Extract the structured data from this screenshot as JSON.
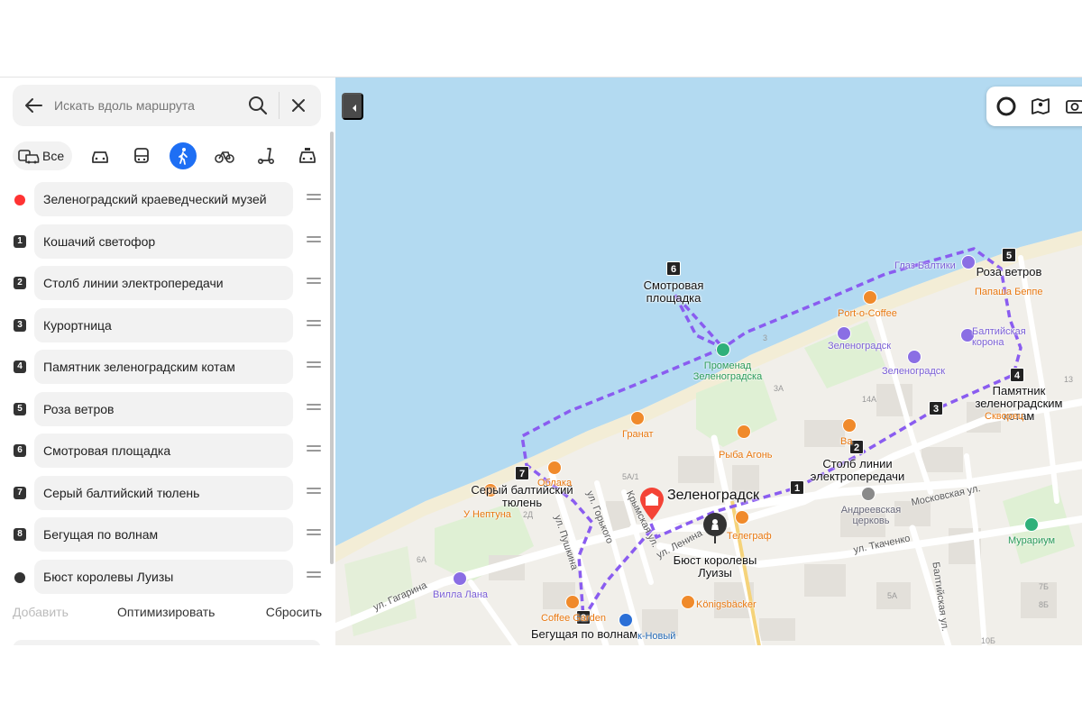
{
  "search": {
    "placeholder": "Искать вдоль маршрута"
  },
  "modes": {
    "all_label": "Все",
    "active": "pedestrian"
  },
  "stops": [
    {
      "marker": "",
      "marker_style": "red-dot",
      "label": "Зеленоградский краеведческий музей"
    },
    {
      "marker": "1",
      "label": "Кошачий светофор"
    },
    {
      "marker": "2",
      "label": "Столб линии электропередачи"
    },
    {
      "marker": "3",
      "label": "Курортница"
    },
    {
      "marker": "4",
      "label": "Памятник зеленоградским котам"
    },
    {
      "marker": "5",
      "label": "Роза ветров"
    },
    {
      "marker": "6",
      "label": "Смотровая площадка"
    },
    {
      "marker": "7",
      "label": "Серый балтийский тюлень"
    },
    {
      "marker": "8",
      "label": "Бегущая по волнам"
    },
    {
      "marker": "",
      "marker_style": "dark-dot",
      "label": "Бюст королевы Луизы"
    }
  ],
  "actions": {
    "add": "Добавить",
    "optimize": "Оптимизировать",
    "reset": "Сбросить"
  },
  "map": {
    "colors": {
      "sea": "#b3daf1",
      "beach": "#f3edd6",
      "land": "#f1efea",
      "park": "#dff0d4",
      "route": "#8a5cf0"
    },
    "route_stops": [
      {
        "num": "1",
        "label": ""
      },
      {
        "num": "2",
        "label": "Столб линии электропередачи"
      },
      {
        "num": "3",
        "label": ""
      },
      {
        "num": "4",
        "label": "Памятник зеленоградским котам"
      },
      {
        "num": "5",
        "label": "Роза ветров"
      },
      {
        "num": "6",
        "label": "Смотровая площадка"
      },
      {
        "num": "7",
        "label": "Серый балтийский тюлень"
      },
      {
        "num": "8",
        "label": "Бегущая по волнам"
      }
    ],
    "start_label": "Зеленоградск",
    "end_label": "Бюст королевы Луизы",
    "pois": {
      "glaz": "Глаз Балтики",
      "papasha": "Папаша Беппе",
      "port_coffee": "Port-o-Coffee",
      "zelenogradsk1": "Зеленоградск",
      "zelenogradsk2": "Зеленоградск",
      "baltic_crown": "Балтийская корона",
      "promenade": "Променад Зеленоградска",
      "granat": "Гранат",
      "ryba": "Рыба Агонь",
      "oblaka": "Облака",
      "neptun": "У Нептуна",
      "telegraf": "Телеграф",
      "church": "Андреевская церковь",
      "skvorets": "Скворец",
      "murarium": "Мурариум",
      "villa": "Вилла Лана",
      "coffee_garden": "Coffee Garden",
      "koenigs": "Königsbäcker",
      "novy": "к-Новый",
      "ba": "Ba"
    },
    "streets": {
      "gagarina": "ул. Гагарина",
      "pushkina": "ул. Пушкина",
      "gorkogo": "ул. Горького",
      "krymskaya": "Крымская ул.",
      "lenina": "ул. Ленина",
      "tkachenko": "ул. Ткаченко",
      "moskovskaya": "Московская ул.",
      "baltiyskaya": "Балтийская ул."
    },
    "houses": [
      "3",
      "3А",
      "14А",
      "5А/1",
      "2Д",
      "6А",
      "5А",
      "7Б",
      "8Б",
      "10Б",
      "13"
    ]
  }
}
